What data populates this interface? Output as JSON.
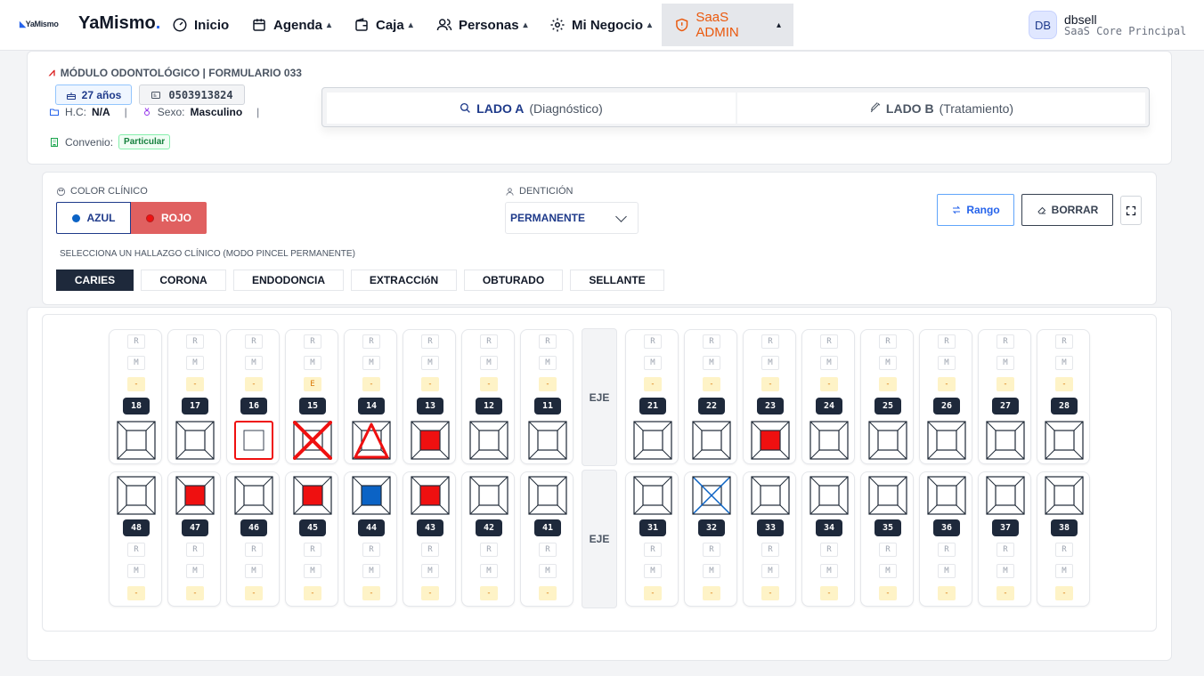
{
  "nav": {
    "logo_small": "YaMismo",
    "brand": "YaMismo",
    "brand_dot": ".",
    "items": [
      {
        "label": "Inicio",
        "chevron": ""
      },
      {
        "label": "Agenda",
        "chevron": "▴"
      },
      {
        "label": "Caja",
        "chevron": "▴"
      },
      {
        "label": "Personas",
        "chevron": "▴"
      },
      {
        "label": "Mi Negocio",
        "chevron": "▴"
      },
      {
        "label": "SaaS ADMIN",
        "chevron": "▴"
      }
    ],
    "user": {
      "initials": "DB",
      "name": "dbsell",
      "role": "SaaS Core Principal"
    }
  },
  "patient": {
    "module_title": "MÓDULO ODONTOLÓGICO | FORMULARIO 033",
    "age": "27 años",
    "id_number": "0503913824",
    "hc_label": "H.C:",
    "hc_value": "N/A",
    "sex_label": "Sexo:",
    "sex_value": "Masculino",
    "sep": "|",
    "convenio_label": "Convenio:",
    "convenio_value": "Particular"
  },
  "side_tabs": {
    "a_bold": "LADO A",
    "a_rest": "(Diagnóstico)",
    "b_bold": "LADO B",
    "b_rest": "(Tratamiento)"
  },
  "toolbar": {
    "color_label": "COLOR CLÍNICO",
    "color_blue": "AZUL",
    "color_red": "ROJO",
    "denticion_label": "DENTICIÓN",
    "denticion_value": "PERMANENTE",
    "range_label": "Rango",
    "clear_label": "BORRAR",
    "finding_label": "SELECCIONA UN HALLAZGO CLÍNICO (MODO PINCEL PERMANENTE)",
    "findings": [
      "CARIES",
      "CORONA",
      "ENDODONCIA",
      "EXTRACCIóN",
      "OBTURADO",
      "SELLANTE"
    ],
    "selected_finding": "CARIES"
  },
  "colors": {
    "blue": "#0b63c5",
    "red": "#ef1010",
    "dark": "#1e293b",
    "accent": "#ea580c"
  },
  "odontogram": {
    "eje_label": "EJE",
    "cell_r": "R",
    "cell_m": "M",
    "upper": [
      {
        "n": "18",
        "s": "-",
        "m": "none"
      },
      {
        "n": "17",
        "s": "-",
        "m": "none"
      },
      {
        "n": "16",
        "s": "-",
        "m": "crown-red"
      },
      {
        "n": "15",
        "s": "E",
        "m": "extraction-red"
      },
      {
        "n": "14",
        "s": "-",
        "m": "triangle-red"
      },
      {
        "n": "13",
        "s": "-",
        "m": "fill-red"
      },
      {
        "n": "12",
        "s": "-",
        "m": "none"
      },
      {
        "n": "11",
        "s": "-",
        "m": "none"
      },
      {
        "n": "21",
        "s": "-",
        "m": "none"
      },
      {
        "n": "22",
        "s": "-",
        "m": "none"
      },
      {
        "n": "23",
        "s": "-",
        "m": "fill-red"
      },
      {
        "n": "24",
        "s": "-",
        "m": "none"
      },
      {
        "n": "25",
        "s": "-",
        "m": "none"
      },
      {
        "n": "26",
        "s": "-",
        "m": "none"
      },
      {
        "n": "27",
        "s": "-",
        "m": "none"
      },
      {
        "n": "28",
        "s": "-",
        "m": "none"
      }
    ],
    "lower": [
      {
        "n": "48",
        "s": "-",
        "m": "none"
      },
      {
        "n": "47",
        "s": "-",
        "m": "fill-red"
      },
      {
        "n": "46",
        "s": "-",
        "m": "none"
      },
      {
        "n": "45",
        "s": "-",
        "m": "fill-red"
      },
      {
        "n": "44",
        "s": "-",
        "m": "fill-blue"
      },
      {
        "n": "43",
        "s": "-",
        "m": "fill-red"
      },
      {
        "n": "42",
        "s": "-",
        "m": "none"
      },
      {
        "n": "41",
        "s": "-",
        "m": "none"
      },
      {
        "n": "31",
        "s": "-",
        "m": "none"
      },
      {
        "n": "32",
        "s": "-",
        "m": "cross-blue"
      },
      {
        "n": "33",
        "s": "-",
        "m": "none"
      },
      {
        "n": "34",
        "s": "-",
        "m": "none"
      },
      {
        "n": "35",
        "s": "-",
        "m": "none"
      },
      {
        "n": "36",
        "s": "-",
        "m": "none"
      },
      {
        "n": "37",
        "s": "-",
        "m": "none"
      },
      {
        "n": "38",
        "s": "-",
        "m": "none"
      }
    ]
  }
}
